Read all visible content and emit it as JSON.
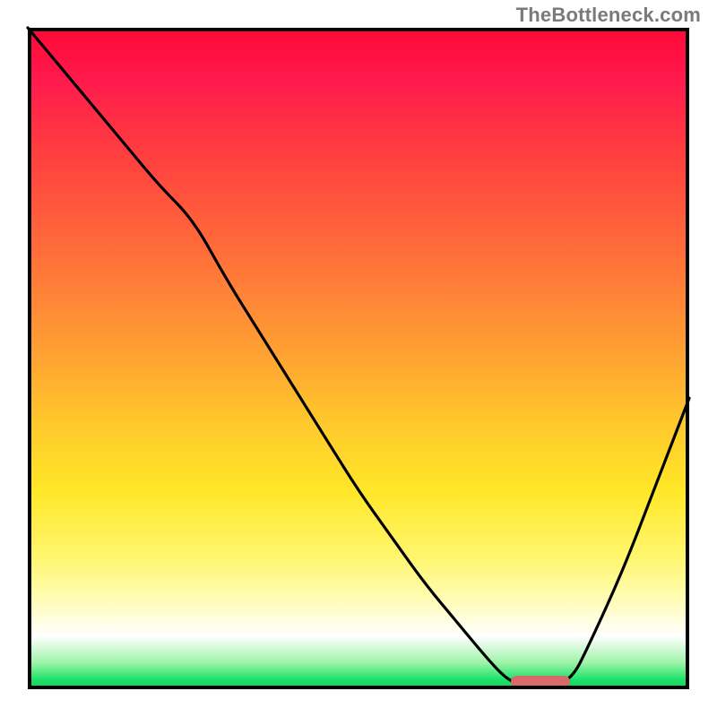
{
  "watermark": {
    "text": "TheBottleneck.com"
  },
  "colors": {
    "line": "#000000",
    "marker": "#d86a6a",
    "frame": "#000000",
    "gradient_top": "#ff0836",
    "gradient_bottom": "#0fd35b"
  },
  "chart_data": {
    "type": "line",
    "title": "",
    "xlabel": "",
    "ylabel": "",
    "xlim": [
      0,
      100
    ],
    "ylim": [
      0,
      100
    ],
    "grid": false,
    "legend": false,
    "annotations": [
      {
        "type": "pill-marker",
        "x_start": 73,
        "x_end": 82,
        "y": 0
      }
    ],
    "series": [
      {
        "name": "curve",
        "x": [
          0,
          5,
          10,
          15,
          20,
          25,
          30,
          35,
          40,
          45,
          50,
          55,
          60,
          65,
          70,
          73,
          77,
          82,
          85,
          90,
          95,
          100
        ],
        "y": [
          100,
          94,
          88,
          82,
          76,
          71,
          62,
          54,
          46,
          38,
          30,
          23,
          16,
          10,
          4,
          1,
          0,
          1,
          7,
          18,
          31,
          44
        ]
      }
    ],
    "gradient_background": {
      "type": "vertical",
      "stops": [
        {
          "pos": 0.0,
          "color": "#ff0836"
        },
        {
          "pos": 0.08,
          "color": "#ff1a4d"
        },
        {
          "pos": 0.18,
          "color": "#ff3b3f"
        },
        {
          "pos": 0.34,
          "color": "#ff6e3a"
        },
        {
          "pos": 0.48,
          "color": "#ff9d33"
        },
        {
          "pos": 0.6,
          "color": "#ffc92c"
        },
        {
          "pos": 0.7,
          "color": "#ffe727"
        },
        {
          "pos": 0.8,
          "color": "#fff66e"
        },
        {
          "pos": 0.86,
          "color": "#fffcb0"
        },
        {
          "pos": 0.92,
          "color": "#ffffff"
        },
        {
          "pos": 0.96,
          "color": "#9ef3a7"
        },
        {
          "pos": 0.985,
          "color": "#1de26a"
        },
        {
          "pos": 1.0,
          "color": "#0fd35b"
        }
      ]
    }
  }
}
